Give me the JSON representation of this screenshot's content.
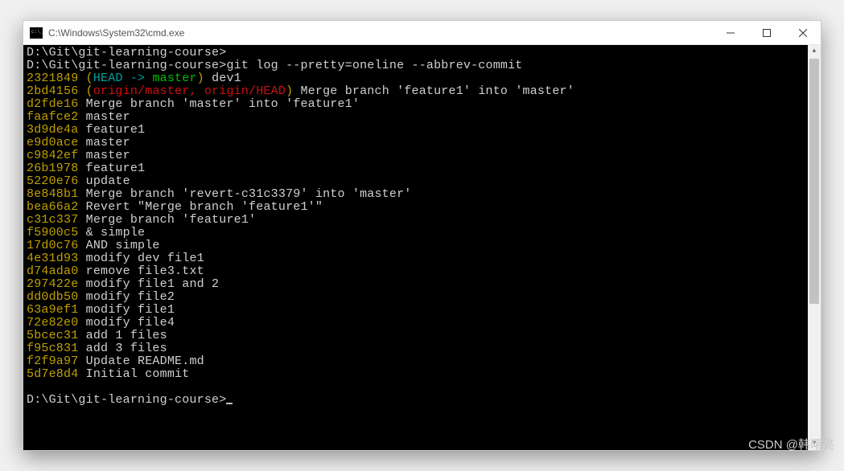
{
  "window": {
    "title": "C:\\Windows\\System32\\cmd.exe"
  },
  "prompt": {
    "path": "D:\\Git\\git-learning-course>",
    "command": "git log --pretty=oneline --abbrev-commit"
  },
  "head_line": {
    "hash": "2321849",
    "open": " (",
    "head_arrow": "HEAD -> ",
    "branch": "master",
    "close": ")",
    "msg": " dev1"
  },
  "origin_line": {
    "hash": "2bd4156",
    "open": " (",
    "refs": "origin/master, origin/HEAD",
    "close": ")",
    "msg": " Merge branch 'feature1' into 'master'"
  },
  "commits": [
    {
      "hash": "d2fde16",
      "msg": " Merge branch 'master' into 'feature1'"
    },
    {
      "hash": "faafce2",
      "msg": " master"
    },
    {
      "hash": "3d9de4a",
      "msg": " feature1"
    },
    {
      "hash": "e9d0ace",
      "msg": " master"
    },
    {
      "hash": "c9842ef",
      "msg": " master"
    },
    {
      "hash": "26b1978",
      "msg": " feature1"
    },
    {
      "hash": "5220e76",
      "msg": " update"
    },
    {
      "hash": "8e848b1",
      "msg": " Merge branch 'revert-c31c3379' into 'master'"
    },
    {
      "hash": "bea66a2",
      "msg": " Revert \"Merge branch 'feature1'\""
    },
    {
      "hash": "c31c337",
      "msg": " Merge branch 'feature1'"
    },
    {
      "hash": "f5900c5",
      "msg": " & simple"
    },
    {
      "hash": "17d0c76",
      "msg": " AND simple"
    },
    {
      "hash": "4e31d93",
      "msg": " modify dev file1"
    },
    {
      "hash": "d74ada0",
      "msg": " remove file3.txt"
    },
    {
      "hash": "297422e",
      "msg": " modify file1 and 2"
    },
    {
      "hash": "dd0db50",
      "msg": " modify file2"
    },
    {
      "hash": "63a9ef1",
      "msg": " modify file1"
    },
    {
      "hash": "72e82e0",
      "msg": " modify file4"
    },
    {
      "hash": "5bcec31",
      "msg": " add 1 files"
    },
    {
      "hash": "f95c831",
      "msg": " add 3 files"
    },
    {
      "hash": "f2f9a97",
      "msg": " Update README.md"
    },
    {
      "hash": "5d7e8d4",
      "msg": " Initial commit"
    }
  ],
  "final_prompt": "D:\\Git\\git-learning-course>",
  "watermark": "CSDN @韩曙亮"
}
